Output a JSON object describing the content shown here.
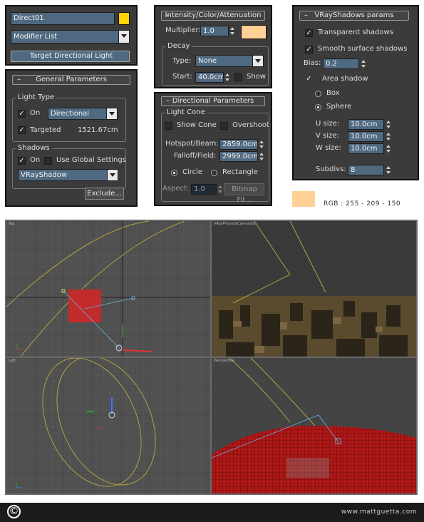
{
  "modify_panel": {
    "object_name": "Direct01",
    "object_color": "#ffd400",
    "modifier_list": "Modifier List",
    "stack_item": "Target Directional Light"
  },
  "general_params": {
    "rollout_title": "General Parameters",
    "light_type_group": "Light Type",
    "on_label": "On",
    "on_checked": true,
    "type_value": "Directional",
    "targeted_label": "Targeted",
    "targeted_checked": true,
    "target_distance": "1521.67cm",
    "shadows_group": "Shadows",
    "shadows_on_label": "On",
    "shadows_on_checked": true,
    "use_global_label": "Use Global Settings",
    "use_global_checked": false,
    "shadow_type": "VRayShadow",
    "exclude_button": "Exclude..."
  },
  "intensity": {
    "rollout_title": "Intensity/Color/Attenuation",
    "multiplier_label": "Multiplier:",
    "multiplier_value": "1.0",
    "color": "#ffd196",
    "decay_group": "Decay",
    "type_label": "Type:",
    "type_value": "None",
    "start_label": "Start:",
    "start_value": "40.0cm",
    "show_label": "Show",
    "show_checked": false
  },
  "directional": {
    "rollout_title": "Directional Parameters",
    "light_cone_group": "Light Cone",
    "show_cone_label": "Show Cone",
    "show_cone_checked": false,
    "overshoot_label": "Overshoot",
    "overshoot_checked": false,
    "hotspot_label": "Hotspot/Beam:",
    "hotspot_value": "2859.0cm",
    "falloff_label": "Falloff/Field:",
    "falloff_value": "2999.0cm",
    "circle_label": "Circle",
    "circle_selected": true,
    "rectangle_label": "Rectangle",
    "rectangle_selected": false,
    "aspect_label": "Aspect:",
    "aspect_value": "1.0",
    "bitmap_fit_button": "Bitmap Fit..."
  },
  "vray_shadows": {
    "rollout_title": "VRayShadows params",
    "transparent_label": "Transparent shadows",
    "transparent_checked": true,
    "smooth_label": "Smooth surface shadows",
    "smooth_checked": true,
    "bias_label": "Bias:",
    "bias_value": "0.2",
    "area_label": "Area shadow",
    "area_checked": true,
    "box_label": "Box",
    "box_selected": false,
    "sphere_label": "Sphere",
    "sphere_selected": true,
    "u_label": "U size:",
    "u_value": "10.0cm",
    "v_label": "V size:",
    "v_value": "10.0cm",
    "w_label": "W size:",
    "w_value": "10.0cm",
    "subdivs_label": "Subdivs:",
    "subdivs_value": "8"
  },
  "color_note": {
    "color": "#ffd196",
    "text": "RGB : 255 - 209 - 150"
  },
  "viewports": {
    "top_label": "Top",
    "camera_label": "VRayPhysicalCamera01",
    "left_label": "Left",
    "perspective_label": "Perspective"
  },
  "footer": {
    "logo": "©",
    "url": "www.mattguetta.com"
  }
}
